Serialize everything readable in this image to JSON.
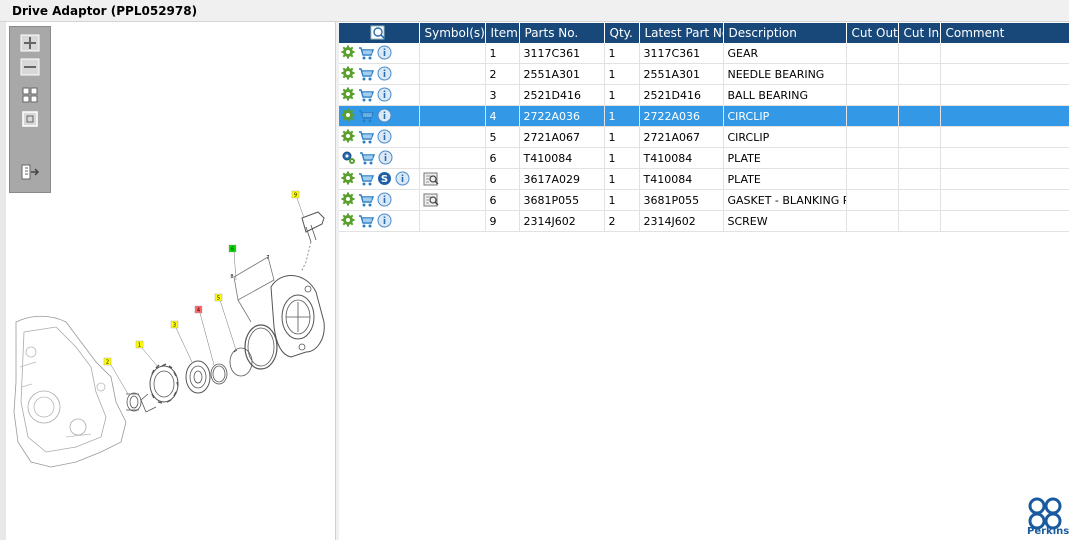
{
  "window": {
    "title": "Drive Adaptor (PPL052978)"
  },
  "columns": [
    "",
    "Symbol(s)",
    "Item",
    "Parts No.",
    "Qty.",
    "Latest Part No.",
    "Description",
    "Cut Out",
    "Cut In",
    "Comment"
  ],
  "rows": [
    {
      "item": "1",
      "part_no": "3117C361",
      "qty": "1",
      "latest": "3117C361",
      "description": "GEAR",
      "icon_type": "gear",
      "has_s": false,
      "symbol": false,
      "selected": false
    },
    {
      "item": "2",
      "part_no": "2551A301",
      "qty": "1",
      "latest": "2551A301",
      "description": "NEEDLE BEARING",
      "icon_type": "gear",
      "has_s": false,
      "symbol": false,
      "selected": false
    },
    {
      "item": "3",
      "part_no": "2521D416",
      "qty": "1",
      "latest": "2521D416",
      "description": "BALL BEARING",
      "icon_type": "gear",
      "has_s": false,
      "symbol": false,
      "selected": false
    },
    {
      "item": "4",
      "part_no": "2722A036",
      "qty": "1",
      "latest": "2722A036",
      "description": "CIRCLIP",
      "icon_type": "gear",
      "has_s": false,
      "symbol": false,
      "selected": true
    },
    {
      "item": "5",
      "part_no": "2721A067",
      "qty": "1",
      "latest": "2721A067",
      "description": "CIRCLIP",
      "icon_type": "gear",
      "has_s": false,
      "symbol": false,
      "selected": false
    },
    {
      "item": "6",
      "part_no": "T410084",
      "qty": "1",
      "latest": "T410084",
      "description": "PLATE",
      "icon_type": "gear-blue",
      "has_s": false,
      "symbol": false,
      "selected": false
    },
    {
      "item": "6",
      "part_no": "3617A029",
      "qty": "1",
      "latest": "T410084",
      "description": "PLATE",
      "icon_type": "gear",
      "has_s": true,
      "symbol": true,
      "selected": false
    },
    {
      "item": "6",
      "part_no": "3681P055",
      "qty": "1",
      "latest": "3681P055",
      "description": "GASKET - BLANKING PLA",
      "icon_type": "gear",
      "has_s": false,
      "symbol": true,
      "selected": false
    },
    {
      "item": "9",
      "part_no": "2314J602",
      "qty": "2",
      "latest": "2314J602",
      "description": "SCREW",
      "icon_type": "gear",
      "has_s": false,
      "symbol": false,
      "selected": false
    }
  ],
  "diagram": {
    "callouts": [
      {
        "label": "1",
        "color": "#ffff00"
      },
      {
        "label": "2",
        "color": "#ffff00"
      },
      {
        "label": "3",
        "color": "#ffff00"
      },
      {
        "label": "4",
        "color": "#ff6666"
      },
      {
        "label": "5",
        "color": "#ffff00"
      },
      {
        "label": "6",
        "color": "#00dd00"
      },
      {
        "label": "7",
        "color": "#ffffff"
      },
      {
        "label": "8",
        "color": "#ffffff"
      },
      {
        "label": "9",
        "color": "#ffff00"
      }
    ]
  },
  "brand": {
    "name": "Perkins"
  },
  "colors": {
    "header": "#18487a",
    "selected_row": "#3399e6",
    "gear_green": "#5aa02c",
    "cart_blue": "#2a7fc4"
  }
}
